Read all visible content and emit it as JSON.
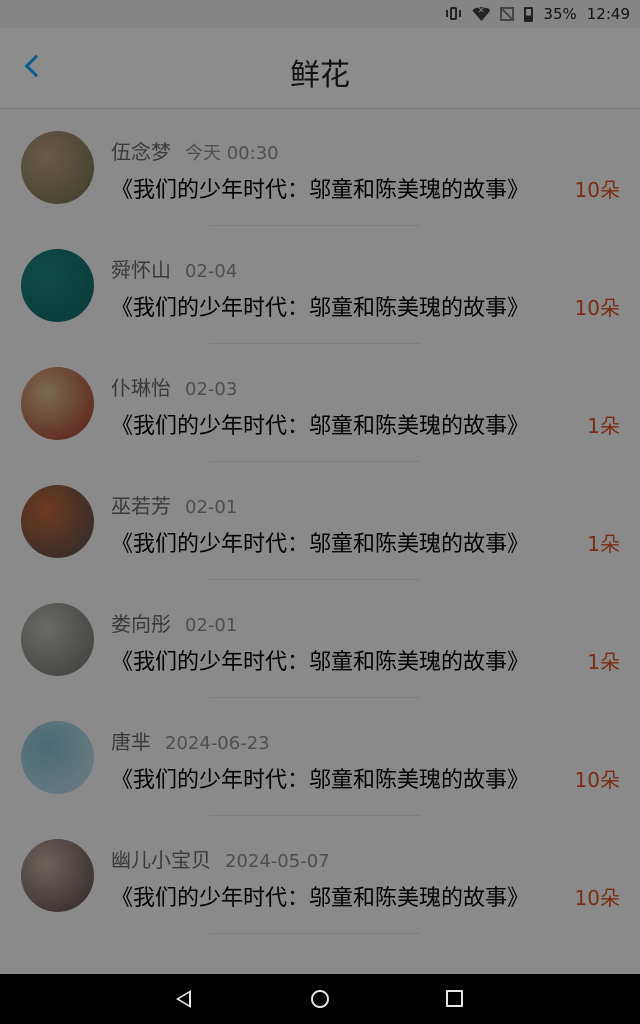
{
  "status": {
    "battery": "35%",
    "time": "12:49"
  },
  "header": {
    "title": "鲜花"
  },
  "rows": [
    {
      "name": "伍念梦",
      "time": "今天 00:30",
      "book": "《我们的少年时代：邬童和陈美瑰的故事》",
      "count": "10朵",
      "avatar_colors": [
        "#6b5a48",
        "#3b3f2a"
      ]
    },
    {
      "name": "舜怀山",
      "time": "02-04",
      "book": "《我们的少年时代：邬童和陈美瑰的故事》",
      "count": "10朵",
      "avatar_colors": [
        "#0e4a4a",
        "#0a3a38"
      ]
    },
    {
      "name": "仆琳怡",
      "time": "02-03",
      "book": "《我们的少年时代：邬童和陈美瑰的故事》",
      "count": "1朵",
      "avatar_colors": [
        "#7a6b52",
        "#5a1a14"
      ]
    },
    {
      "name": "巫若芳",
      "time": "02-01",
      "book": "《我们的少年时代：邬童和陈美瑰的故事》",
      "count": "1朵",
      "avatar_colors": [
        "#6e3a22",
        "#2a2a2a"
      ]
    },
    {
      "name": "娄向彤",
      "time": "02-01",
      "book": "《我们的少年时代：邬童和陈美瑰的故事》",
      "count": "1朵",
      "avatar_colors": [
        "#6a6a66",
        "#3c3c3a"
      ]
    },
    {
      "name": "唐芈",
      "time": "2024-06-23",
      "book": "《我们的少年时代：邬童和陈美瑰的故事》",
      "count": "10朵",
      "avatar_colors": [
        "#4a6a76",
        "#6f7d82"
      ]
    },
    {
      "name": "幽儿小宝贝",
      "time": "2024-05-07",
      "book": "《我们的少年时代：邬童和陈美瑰的故事》",
      "count": "10朵",
      "avatar_colors": [
        "#6e625c",
        "#2e2624"
      ]
    }
  ]
}
